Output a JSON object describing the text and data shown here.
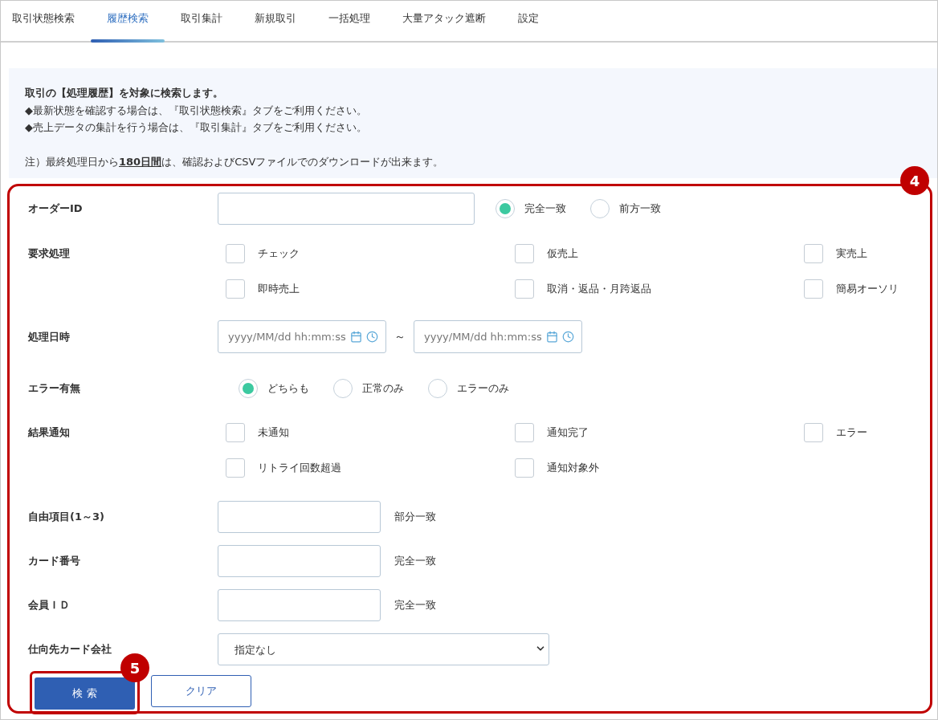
{
  "tabs": [
    {
      "label": "取引状態検索",
      "selected": false
    },
    {
      "label": "履歴検索",
      "selected": true
    },
    {
      "label": "取引集計",
      "selected": false
    },
    {
      "label": "新規取引",
      "selected": false
    },
    {
      "label": "一括処理",
      "selected": false
    },
    {
      "label": "大量アタック遮断",
      "selected": false
    },
    {
      "label": "設定",
      "selected": false
    }
  ],
  "notice": {
    "title": "取引の【処理履歴】を対象に検索します。",
    "lines": [
      "◆最新状態を確認する場合は、『取引状態検索』タブをご利用ください。",
      "◆売上データの集計を行う場合は、『取引集計』タブをご利用ください。"
    ],
    "note": "注）最終処理日から**180日間**は、確認およびCSVファイルでのダウンロードが出来ます。"
  },
  "form": {
    "badge": "4",
    "rows": [
      {
        "kind": "text_match",
        "label": "オーダーID",
        "options": [
          {
            "label": "完全一致",
            "selected": true
          },
          {
            "label": "前方一致",
            "selected": false
          }
        ]
      },
      {
        "kind": "checkboxes",
        "label": "要求処理",
        "options": [
          {
            "label": "チェック",
            "checked": false
          },
          {
            "label": "仮売上",
            "checked": false
          },
          {
            "label": "実売上",
            "checked": false
          },
          {
            "label": "即時売上",
            "checked": false
          },
          {
            "label": "取消・返品・月跨返品",
            "checked": false
          },
          {
            "label": "簡易オーソリ",
            "checked": false
          }
        ]
      },
      {
        "kind": "datetime_range",
        "label": "処理日時",
        "placeholders": [
          "yyyy/MM/dd hh:mm:ss",
          "yyyy/MM/dd hh:mm:ss"
        ],
        "separator": "～"
      },
      {
        "kind": "radios",
        "label": "エラー有無",
        "options": [
          {
            "label": "どちらも",
            "selected": true
          },
          {
            "label": "正常のみ",
            "selected": false
          },
          {
            "label": "エラーのみ",
            "selected": false
          }
        ]
      },
      {
        "kind": "checkboxes",
        "label": "結果通知",
        "options": [
          {
            "label": "未通知",
            "checked": false
          },
          {
            "label": "通知完了",
            "checked": false
          },
          {
            "label": "エラー",
            "checked": false
          },
          {
            "label": "リトライ回数超過",
            "checked": false
          },
          {
            "label": "通知対象外",
            "checked": false
          }
        ]
      },
      {
        "kind": "text_suffix",
        "label": "自由項目(1～3)",
        "suffix": "部分一致"
      },
      {
        "kind": "text_suffix",
        "label": "カード番号",
        "suffix": "完全一致"
      },
      {
        "kind": "text_suffix",
        "label": "会員ＩＤ",
        "suffix": "完全一致"
      },
      {
        "kind": "select",
        "label": "仕向先カード会社",
        "value": "指定なし"
      }
    ],
    "buttons": {
      "search": "検 索",
      "clear": "クリア",
      "badge": "5"
    }
  }
}
